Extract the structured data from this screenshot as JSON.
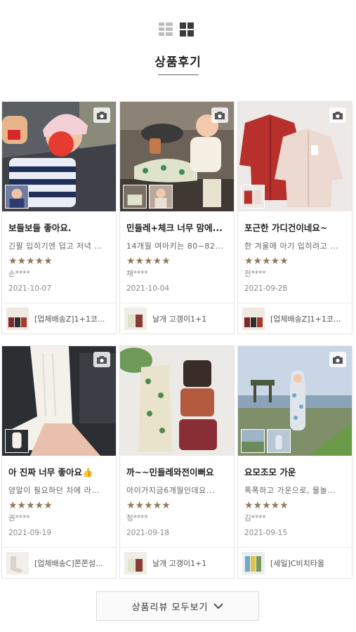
{
  "section": {
    "title": "상품후기"
  },
  "reviews": [
    {
      "title": "보들보들 좋아요.",
      "body": "긴팔 입히기엔 덥고 저녁 ...",
      "rating": 5,
      "stars": "★★★★★",
      "user": "손****",
      "date": "2021-10-07",
      "product": "[업체배송Z]1+1코...",
      "photo_count": 2
    },
    {
      "title": "민들레+체크 너무 맘에...",
      "body": "14개월 여아키는 80~82...",
      "rating": 5,
      "stars": "★★★★★",
      "user": "채****",
      "date": "2021-10-04",
      "product": "날개 고갱이1+1",
      "photo_count": 3
    },
    {
      "title": "포근한 가디건이네요~",
      "body": "한 겨울에 아기 입히려고 ...",
      "rating": 5,
      "stars": "★★★★★",
      "user": "전****",
      "date": "2021-09-28",
      "product": "[업체배송Z]1+1코...",
      "photo_count": 2
    },
    {
      "title": "아 진짜 너무 좋아요👍",
      "body": "양말이 필요하던 차에 라...",
      "rating": 5,
      "stars": "★★★★★",
      "user": "권****",
      "date": "2021-09-19",
      "product": "[업체배송C]쫀쫀성...",
      "photo_count": 2
    },
    {
      "title": "까~~민들레와전이뻐요",
      "body": "아이가지금6개월인데요...",
      "rating": 5,
      "stars": "★★★★★",
      "user": "정****",
      "date": "2021-09-18",
      "product": "날개 고갱이1+1",
      "photo_count": 1
    },
    {
      "title": "요모조모 가운",
      "body": "폭폭하고 가운으로, 물놀...",
      "rating": 5,
      "stars": "★★★★★",
      "user": "김****",
      "date": "2021-09-15",
      "product": "[세일]C비치타올",
      "photo_count": 3
    }
  ],
  "more_button": {
    "label": "상품리뷰 모두보기"
  },
  "icons": {
    "list_view": "list-view-icon",
    "grid_view": "grid-view-icon",
    "camera": "camera-icon",
    "chevron": "chevron-down-icon"
  },
  "colors": {
    "star": "#8f7a5b",
    "grid_active": "#3a3a3a",
    "grid_inactive": "#bdbdbd"
  }
}
